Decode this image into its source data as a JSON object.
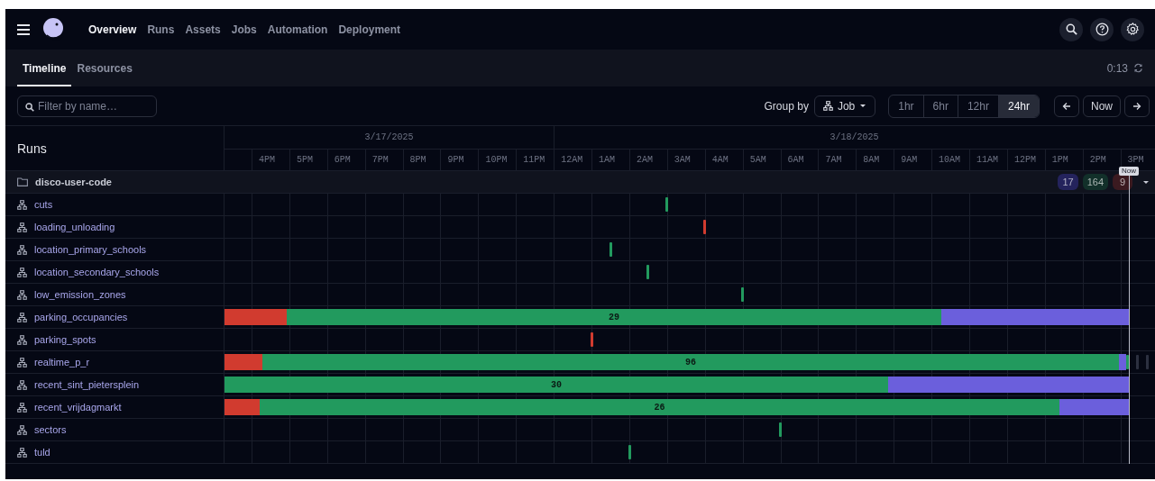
{
  "nav": {
    "items": [
      {
        "label": "Overview",
        "selected": true
      },
      {
        "label": "Runs",
        "selected": false
      },
      {
        "label": "Assets",
        "selected": false
      },
      {
        "label": "Jobs",
        "selected": false
      },
      {
        "label": "Automation",
        "selected": false
      },
      {
        "label": "Deployment",
        "selected": false
      }
    ]
  },
  "tabs": [
    {
      "label": "Timeline",
      "selected": true
    },
    {
      "label": "Resources",
      "selected": false
    }
  ],
  "refresh": {
    "countdown": "0:13"
  },
  "filter": {
    "placeholder": "Filter by name…"
  },
  "group_by": {
    "label": "Group by",
    "value": "Job"
  },
  "ranges": [
    {
      "label": "1hr",
      "selected": false
    },
    {
      "label": "6hr",
      "selected": false
    },
    {
      "label": "12hr",
      "selected": false
    },
    {
      "label": "24hr",
      "selected": true
    }
  ],
  "now_button": "Now",
  "timeline": {
    "title": "Runs",
    "dates": [
      "3/17/2025",
      "3/18/2025"
    ],
    "hours": [
      "4PM",
      "5PM",
      "6PM",
      "7PM",
      "8PM",
      "9PM",
      "10PM",
      "11PM",
      "12AM",
      "1AM",
      "2AM",
      "3AM",
      "4AM",
      "5AM",
      "6AM",
      "7AM",
      "8AM",
      "9AM",
      "10AM",
      "11AM",
      "12PM",
      "1PM",
      "2PM",
      "3PM"
    ],
    "now": {
      "label": "Now"
    },
    "group": {
      "name": "disco-user-code",
      "badges": [
        {
          "color": "#24235c",
          "text": "17"
        },
        {
          "color": "#12302a",
          "text": "164"
        },
        {
          "color": "#3b1a20",
          "text": "9"
        }
      ]
    },
    "rows": [
      {
        "name": "cuts",
        "runs": [
          {
            "color": "#229a5e"
          }
        ]
      },
      {
        "name": "loading_unloading",
        "runs": [
          {
            "color": "#d13b2f"
          }
        ]
      },
      {
        "name": "location_primary_schools",
        "runs": [
          {
            "color": "#229a5e"
          }
        ]
      },
      {
        "name": "location_secondary_schools",
        "runs": [
          {
            "color": "#229a5e"
          }
        ]
      },
      {
        "name": "low_emission_zones",
        "runs": [
          {
            "color": "#229a5e"
          }
        ]
      },
      {
        "name": "parking_occupancies",
        "runs": [
          {
            "color": "#d13b2f"
          },
          {
            "color": "#229a5e",
            "count": "29"
          },
          {
            "color": "#6b5fdc"
          }
        ]
      },
      {
        "name": "parking_spots",
        "runs": [
          {
            "color": "#d13b2f"
          }
        ]
      },
      {
        "name": "realtime_p_r",
        "runs": [
          {
            "color": "#d13b2f"
          },
          {
            "color": "#229a5e",
            "count": "96"
          },
          {
            "color": "#6b5fdc"
          },
          {
            "color": "#229a5e"
          },
          {
            "color": "#2c3040"
          },
          {
            "color": "#2c3040"
          }
        ]
      },
      {
        "name": "recent_sint_pietersplein",
        "runs": [
          {
            "color": "#229a5e",
            "count": "30"
          },
          {
            "color": "#6b5fdc"
          }
        ]
      },
      {
        "name": "recent_vrijdagmarkt",
        "runs": [
          {
            "color": "#d13b2f"
          },
          {
            "color": "#229a5e",
            "count": "26"
          },
          {
            "color": "#6b5fdc"
          }
        ]
      },
      {
        "name": "sectors",
        "runs": [
          {
            "color": "#229a5e"
          }
        ]
      },
      {
        "name": "tuld",
        "runs": [
          {
            "color": "#229a5e"
          }
        ]
      }
    ]
  }
}
